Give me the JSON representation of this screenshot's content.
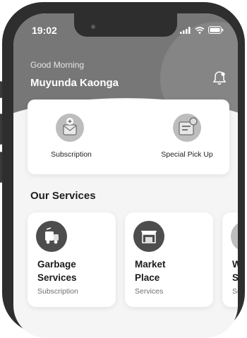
{
  "status_bar": {
    "time": "19:02"
  },
  "header": {
    "greeting": "Good Morning",
    "user_name": "Muyunda Kaonga"
  },
  "quick_services": [
    {
      "label": "Subscription"
    },
    {
      "label": "Special Pick Up"
    }
  ],
  "section_title": "Our Services",
  "services": [
    {
      "title_line1": "Garbage",
      "title_line2": "Services",
      "subtitle": "Subscription"
    },
    {
      "title_line1": "Market",
      "title_line2": "Place",
      "subtitle": "Services"
    },
    {
      "title_line1": "W",
      "title_line2": "Se",
      "subtitle": "Se"
    }
  ],
  "colors": {
    "header": "#777777",
    "card_icon": "#4d4d4d",
    "background": "#f5f5f5"
  }
}
